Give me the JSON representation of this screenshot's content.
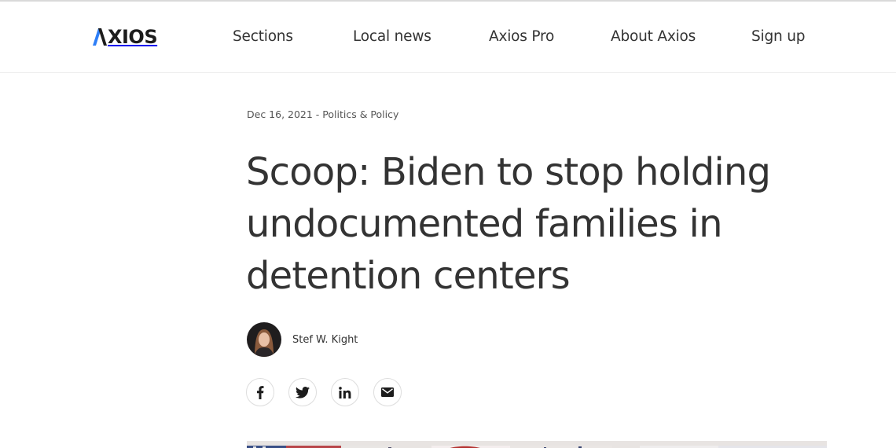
{
  "header": {
    "logo_text": "XIOS",
    "nav": [
      {
        "label": "Sections"
      },
      {
        "label": "Local news"
      },
      {
        "label": "Axios Pro"
      },
      {
        "label": "About Axios"
      },
      {
        "label": "Sign up"
      }
    ]
  },
  "article": {
    "date": "Dec 16, 2021",
    "separator": " - ",
    "category": "Politics & Policy",
    "headline": "Scoop: Biden to stop holding undocumented families in detention centers",
    "author": "Stef W. Kight",
    "share_icons": [
      "facebook-icon",
      "twitter-icon",
      "linkedin-icon",
      "email-icon"
    ]
  },
  "colors": {
    "text": "#333333",
    "logo_accent": "#2d7ef7",
    "border": "#dddddd"
  }
}
